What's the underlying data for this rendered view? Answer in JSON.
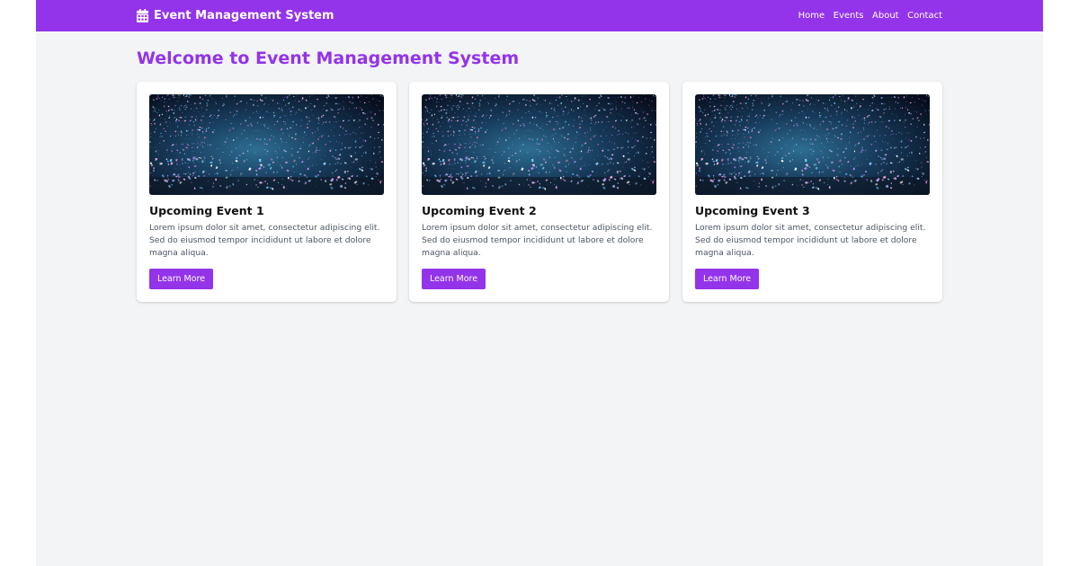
{
  "brand": {
    "title": "Event Management System",
    "icon": "calendar-icon"
  },
  "nav": {
    "links": [
      {
        "label": "Home"
      },
      {
        "label": "Events"
      },
      {
        "label": "About"
      },
      {
        "label": "Contact"
      }
    ]
  },
  "main": {
    "heading": "Welcome to Event Management System"
  },
  "events": [
    {
      "title": "Upcoming Event 1",
      "description": "Lorem ipsum dolor sit amet, consectetur adipiscing elit. Sed do eiusmod tempor incididunt ut labore et dolore magna aliqua.",
      "button_label": "Learn More"
    },
    {
      "title": "Upcoming Event 2",
      "description": "Lorem ipsum dolor sit amet, consectetur adipiscing elit. Sed do eiusmod tempor incididunt ut labore et dolore magna aliqua.",
      "button_label": "Learn More"
    },
    {
      "title": "Upcoming Event 3",
      "description": "Lorem ipsum dolor sit amet, consectetur adipiscing elit. Sed do eiusmod tempor incididunt ut labore et dolore magna aliqua.",
      "button_label": "Learn More"
    }
  ],
  "colors": {
    "brand": "#9333ea",
    "background": "#f3f4f6",
    "card": "#ffffff",
    "text_muted": "#4b5563"
  }
}
